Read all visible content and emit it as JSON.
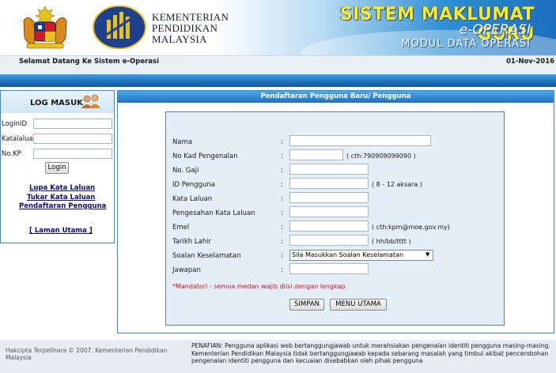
{
  "header": {
    "ministry_line1": "KEMENTERIAN",
    "ministry_line2": "PENDIDIKAN",
    "ministry_line3": "MALAYSIA",
    "system_title": "SISTEM MAKLUMAT GURU",
    "system_subtitle": "e-OPERASI",
    "system_module": "MODUL DATA OPERASI"
  },
  "welcome": {
    "text": "Selamat Datang Ke Sistem e-Operasi",
    "date": "01-Nov-2016"
  },
  "login": {
    "title": "LOG MASUK",
    "loginid_label": "LoginID",
    "password_label": "Katalaluan",
    "kp_label": "No.KP",
    "button_label": "Login",
    "link_forgot": "Lupa Kata Laluan",
    "link_change": "Tukar Kata Laluan",
    "link_register": "Pendaftaran Pengguna",
    "link_home": "[ Laman Utama ]"
  },
  "registration": {
    "title": "Pendaftaran Pengguna Baru/ Pengguna",
    "colon": ":",
    "fields": {
      "nama": "Nama",
      "no_kp": "No Kad Pengenalan",
      "no_gaji": "No. Gaji",
      "id_pengguna": "ID Pengguna",
      "kata_laluan": "Kata Laluan",
      "pengesahan": "Pengesahan Kata Laluan",
      "emel": "Emel",
      "tarikh_lahir": "Tarikh Lahir",
      "soalan": "Soalan Keselamatan",
      "jawapan": "Jawapan"
    },
    "hints": {
      "no_kp": "( cth:790909099090 )",
      "id_pengguna": "( 8 - 12 aksara )",
      "emel": "( cth:kpm@moe.gov.my)",
      "tarikh_lahir": "( hh/bb/tttt )"
    },
    "security_selected": "Sila Masukkan Soalan Keselamatan",
    "mandatory_note": "*Mandatori - semua medan wajib diisi dengan lengkap.",
    "save_button": "SIMPAN",
    "menu_button": "MENU UTAMA"
  },
  "footer": {
    "copyright": "Hakcipta Terpelihara © 2007. Kementerian Pendidikan Malaysia",
    "disclaimer": "PENAFIAN: Pengguna aplikasi web bertanggungjawab untuk merahsiakan pengenalan identiti pengguna masing-masing. Kementerian Pendidikan Malaysia tidak bertanggungjawab kepada sebarang masalah yang timbul akibat pencerobohan pengenalan identiti pengguna dan kecuaian disebabkan oleh pihak pengguna"
  },
  "colors": {
    "accent_blue": "#1e6fb9",
    "title_yellow": "#f6ea2a",
    "mandatory_red": "#d0102a",
    "link_navy": "#0d0d7a"
  },
  "icons": [
    "coat-of-arms-icon",
    "moe-logo-icon",
    "users-login-icon",
    "chevron-down-icon"
  ]
}
